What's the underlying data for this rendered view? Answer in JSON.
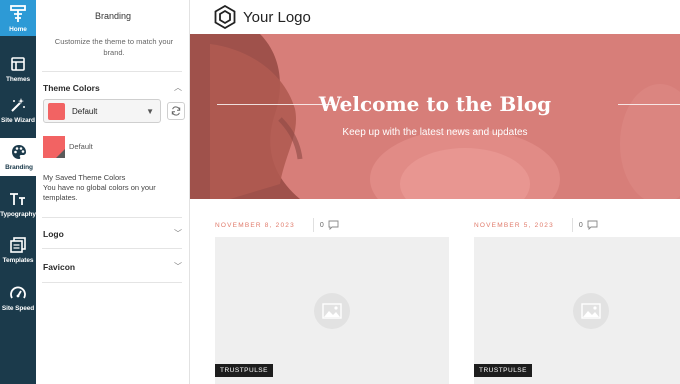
{
  "colors": {
    "rail_bg": "#1b3a4b",
    "home_bg": "#2d9ad6",
    "theme_red": "#f26363",
    "hero_overlay": "#e16e6e"
  },
  "rail": {
    "items": [
      {
        "label": "Home",
        "icon": "home-logo-icon"
      },
      {
        "label": "Themes",
        "icon": "themes-icon"
      },
      {
        "label": "Site Wizard",
        "icon": "magic-wand-icon"
      },
      {
        "label": "Branding",
        "icon": "palette-icon"
      },
      {
        "label": "Typography",
        "icon": "typography-icon"
      },
      {
        "label": "Templates",
        "icon": "templates-icon"
      },
      {
        "label": "Site Speed",
        "icon": "speedometer-icon"
      }
    ],
    "active": "Branding"
  },
  "panel": {
    "title": "Branding",
    "description": "Customize the theme to match your brand.",
    "theme_colors": {
      "heading": "Theme Colors",
      "selected": "Default",
      "swatch_label": "Default",
      "saved_heading": "My Saved Theme Colors",
      "saved_empty": "You have no global colors on your templates."
    },
    "logo_heading": "Logo",
    "favicon_heading": "Favicon"
  },
  "preview": {
    "logo_text": "Your Logo",
    "hero_title": "Welcome to the Blog",
    "hero_subtitle": "Keep up with the latest news and updates",
    "posts": [
      {
        "date": "NOVEMBER 8, 2023",
        "comments": "0",
        "tag": "TRUSTPULSE"
      },
      {
        "date": "NOVEMBER 5, 2023",
        "comments": "0",
        "tag": "TRUSTPULSE"
      }
    ]
  }
}
